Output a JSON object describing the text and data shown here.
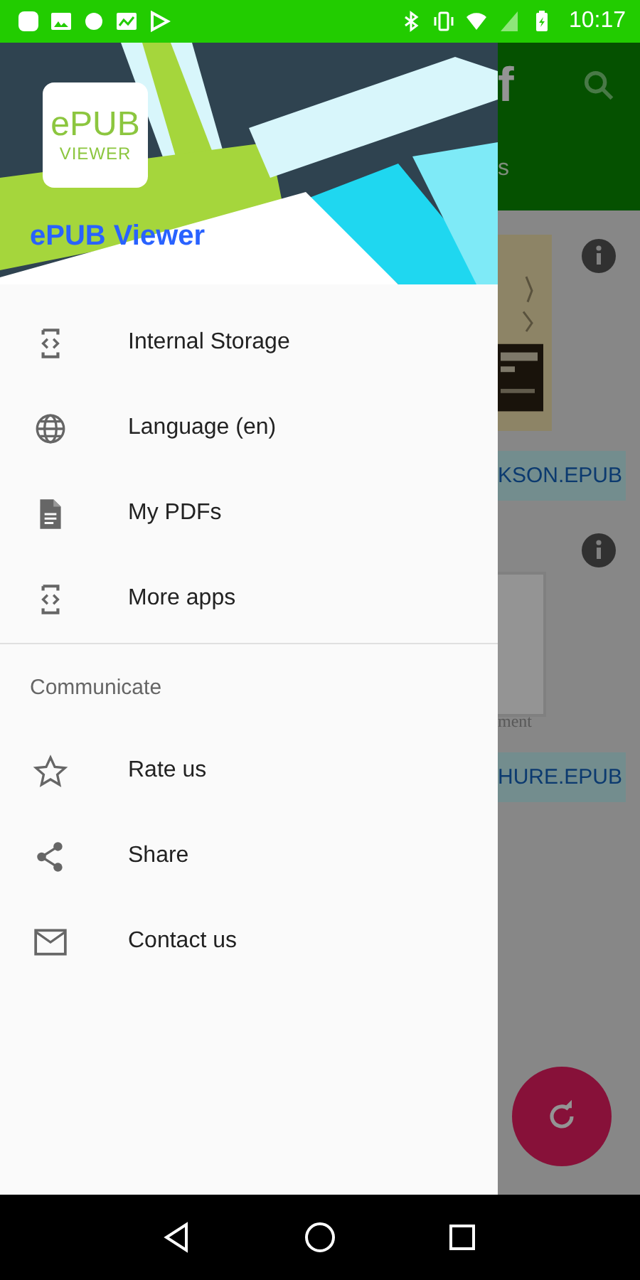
{
  "status_bar": {
    "time": "10:17"
  },
  "drawer": {
    "header": {
      "logo_top": "ePUB",
      "logo_bottom": "VIEWER",
      "title": "ePUB Viewer"
    },
    "items": [
      {
        "label": "Internal Storage",
        "kind": "code"
      },
      {
        "label": "Language (en)",
        "kind": "globe"
      },
      {
        "label": "My PDFs",
        "kind": "document"
      },
      {
        "label": "More apps",
        "kind": "code"
      }
    ],
    "section_title": "Communicate",
    "section_items": [
      {
        "label": "Rate us",
        "kind": "star"
      },
      {
        "label": "Share",
        "kind": "share"
      },
      {
        "label": "Contact us",
        "kind": "mail"
      }
    ]
  },
  "background": {
    "app_bar_glyph": "f",
    "tab_label": "s",
    "files": [
      {
        "kind": "picture",
        "name": "KSON.EPUB"
      },
      {
        "kind": "blank",
        "caption": "ment",
        "name": "HURE.EPUB"
      }
    ]
  }
}
